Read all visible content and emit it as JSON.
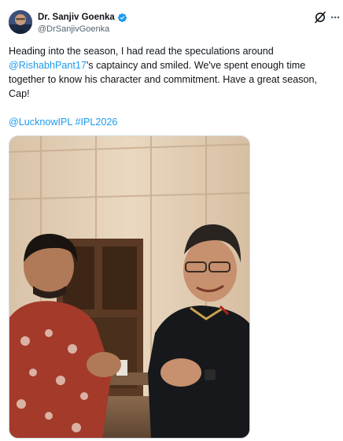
{
  "author": {
    "display_name": "Dr. Sanjiv Goenka",
    "handle": "@DrSanjivGoenka",
    "verified": true
  },
  "icons": {
    "verified": "verified-badge-icon",
    "grok": "grok-icon",
    "more": "more-options-icon"
  },
  "tweet": {
    "text_before_mention": "Heading into the season, I had read the speculations around ",
    "mention": "@RishabhPant17",
    "text_after_mention": "'s captaincy and smiled. We've spent enough time together to know his character and commitment. Have a great season, Cap!",
    "mention_lucknow": "@LucknowIPL",
    "hashtag": "#IPL2026"
  },
  "colors": {
    "link": "#1d9bf0",
    "verified": "#1d9bf0",
    "text": "#0f1419",
    "secondary": "#536471"
  }
}
